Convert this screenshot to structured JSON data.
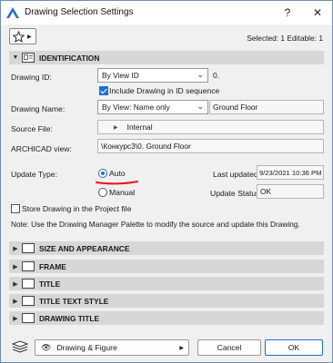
{
  "window": {
    "title": "Drawing Selection Settings",
    "help_label": "?",
    "close_label": "✕"
  },
  "toolbar": {
    "selection_info": "Selected: 1 Editable: 1"
  },
  "sections": {
    "identification": "IDENTIFICATION",
    "collapsed": [
      "SIZE AND APPEARANCE",
      "FRAME",
      "TITLE",
      "TITLE TEXT STYLE",
      "DRAWING TITLE"
    ]
  },
  "identification": {
    "drawing_id_label": "Drawing ID:",
    "drawing_id_mode": "By View ID",
    "drawing_id_value": "0.",
    "include_in_sequence_label": "Include Drawing in ID sequence",
    "include_in_sequence_checked": true,
    "drawing_name_label": "Drawing Name:",
    "drawing_name_mode": "By View: Name only",
    "drawing_name_value": "Ground Floor",
    "source_file_label": "Source File:",
    "source_file_value": "Internal",
    "archicad_view_label": "ARCHICAD view:",
    "archicad_view_value": "\\Конкурс3\\0. Ground Floor",
    "update_type_label": "Update Type:",
    "update_auto_label": "Auto",
    "update_manual_label": "Manual",
    "update_selected": "Auto",
    "last_updated_label": "Last updated:",
    "last_updated_value": "9/23/2021 10:36 PM",
    "update_status_label": "Update Status:",
    "update_status_value": "OK",
    "store_in_project_label": "Store Drawing in the Project file",
    "store_in_project_checked": false,
    "note": "Note: Use the Drawing Manager Palette to modify the source and update this Drawing."
  },
  "footer": {
    "category_label": "Drawing & Figure",
    "cancel_label": "Cancel",
    "ok_label": "OK"
  },
  "colors": {
    "accent": "#1e6fcf",
    "annotation_underline": "#e8141a"
  }
}
